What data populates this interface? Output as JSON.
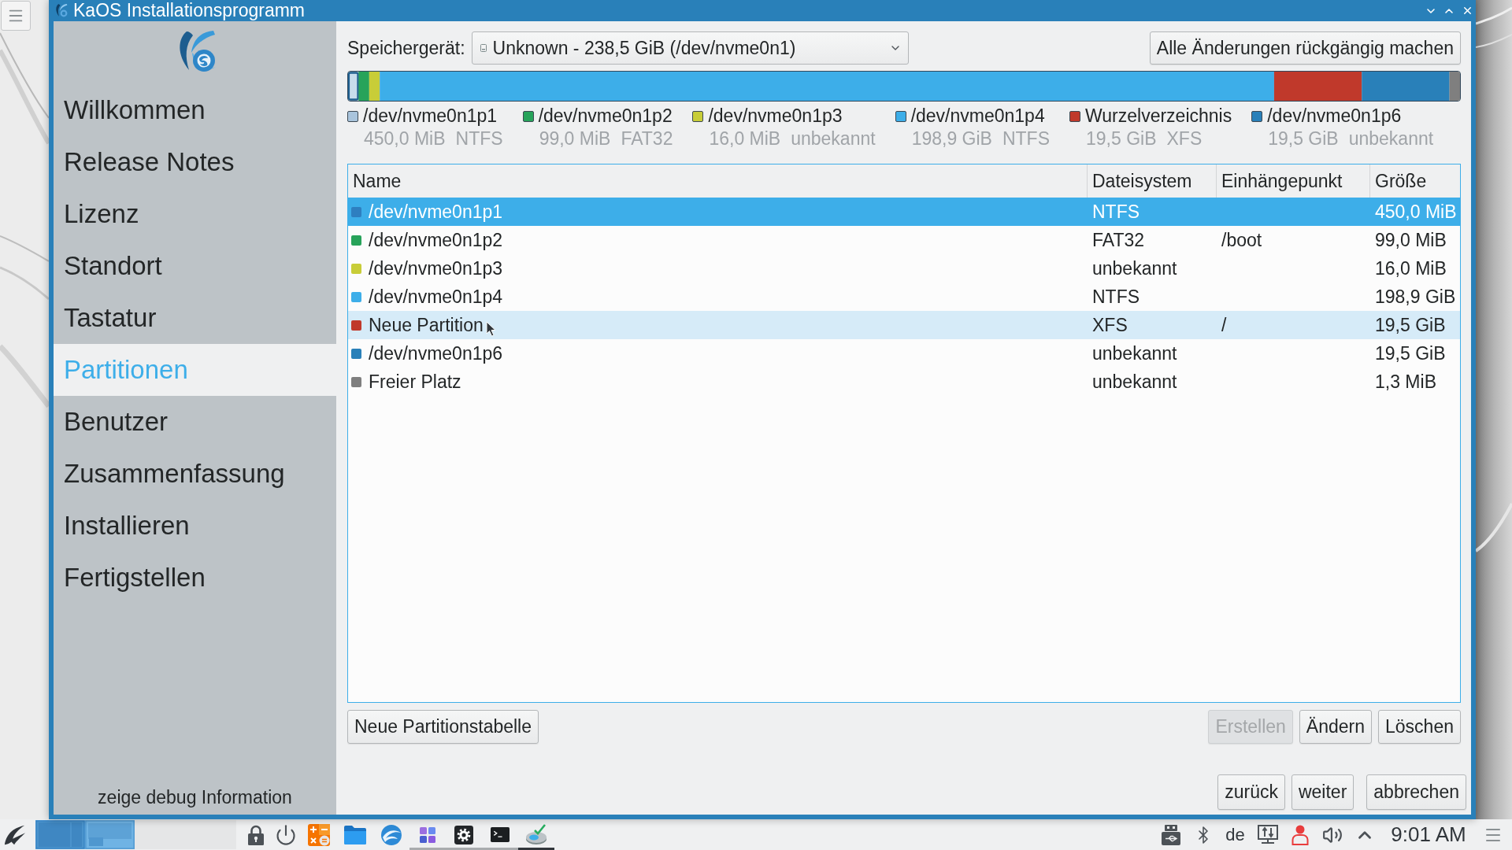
{
  "window": {
    "title": "KaOS Installationsprogramm"
  },
  "sidebar": {
    "items": [
      {
        "label": "Willkommen",
        "selected": false
      },
      {
        "label": "Release Notes",
        "selected": false
      },
      {
        "label": "Lizenz",
        "selected": false
      },
      {
        "label": "Standort",
        "selected": false
      },
      {
        "label": "Tastatur",
        "selected": false
      },
      {
        "label": "Partitionen",
        "selected": true
      },
      {
        "label": "Benutzer",
        "selected": false
      },
      {
        "label": "Zusammenfassung",
        "selected": false
      },
      {
        "label": "Installieren",
        "selected": false
      },
      {
        "label": "Fertigstellen",
        "selected": false
      }
    ],
    "debug_button": "zeige debug Information"
  },
  "device": {
    "label": "Speichergerät:",
    "value": "Unknown - 238,5 GiB (/dev/nvme0n1)"
  },
  "revert_button": {
    "label": "Alle Änderungen rückgängig machen",
    "disabled": false
  },
  "legend": [
    {
      "name": "/dev/nvme0n1p1",
      "color": "#a9c4dc",
      "size": "450,0 MiB",
      "filesystem": "NTFS"
    },
    {
      "name": "/dev/nvme0n1p2",
      "color": "#27a35a",
      "size": "99,0 MiB",
      "filesystem": "FAT32"
    },
    {
      "name": "/dev/nvme0n1p3",
      "color": "#c8cd38",
      "size": "16,0 MiB",
      "filesystem": "unbekannt"
    },
    {
      "name": "/dev/nvme0n1p4",
      "color": "#3daee9",
      "size": "198,9 GiB",
      "filesystem": "NTFS"
    },
    {
      "name": "Wurzelverzeichnis",
      "color": "#c0392b",
      "size": "19,5 GiB",
      "filesystem": "XFS"
    },
    {
      "name": "/dev/nvme0n1p6",
      "color": "#2980b9",
      "size": "19,5 GiB",
      "filesystem": "unbekannt"
    }
  ],
  "table": {
    "columns": [
      "Name",
      "Dateisystem",
      "Einhängepunkt",
      "Größe"
    ],
    "rows": [
      {
        "name": "/dev/nvme0n1p1",
        "color": "#2e7fc0",
        "filesystem": "NTFS",
        "size": "450,0 MiB",
        "selected": true,
        "hovered": false
      },
      {
        "name": "/dev/nvme0n1p2",
        "color": "#27a35a",
        "filesystem": "FAT32",
        "mount": "/boot",
        "size": "99,0 MiB",
        "selected": false,
        "hovered": false
      },
      {
        "name": "/dev/nvme0n1p3",
        "color": "#c8cd38",
        "filesystem": "unbekannt",
        "size": "16,0 MiB",
        "selected": false,
        "hovered": false
      },
      {
        "name": "/dev/nvme0n1p4",
        "color": "#3daee9",
        "filesystem": "NTFS",
        "size": "198,9 GiB",
        "selected": false,
        "hovered": false
      },
      {
        "name": "Neue Partition",
        "color": "#c0392b",
        "filesystem": "XFS",
        "mount": "/",
        "size": "19,5 GiB",
        "selected": false,
        "hovered": true
      },
      {
        "name": "/dev/nvme0n1p6",
        "color": "#2980b9",
        "filesystem": "unbekannt",
        "size": "19,5 GiB",
        "selected": false,
        "hovered": false
      },
      {
        "name": "Freier Platz",
        "color": "#7f7f7f",
        "filesystem": "unbekannt",
        "size": "1,3 MiB",
        "selected": false,
        "hovered": false
      }
    ]
  },
  "partition_buttons": {
    "left": [
      {
        "label": "Neue Partitionstabelle",
        "disabled": false
      }
    ],
    "right": [
      {
        "label": "Erstellen",
        "disabled": true
      },
      {
        "label": "Ändern",
        "disabled": false
      },
      {
        "label": "Löschen",
        "disabled": false
      }
    ]
  },
  "nav_buttons": [
    {
      "label": "zurück",
      "disabled": false
    },
    {
      "label": "weiter",
      "disabled": false
    }
  ],
  "cancel_button": {
    "label": "abbrechen",
    "disabled": false
  },
  "taskbar": {
    "launchers": [
      {
        "kind": "lock",
        "running": false,
        "active": false
      },
      {
        "kind": "power",
        "running": false,
        "active": false
      },
      {
        "kind": "calculator",
        "running": false,
        "active": false
      },
      {
        "kind": "folder",
        "running": false,
        "active": false
      },
      {
        "kind": "browser",
        "running": false,
        "active": false
      },
      {
        "kind": "grid",
        "running": true,
        "active": false
      },
      {
        "kind": "settings",
        "running": true,
        "active": false
      },
      {
        "kind": "terminal",
        "running": true,
        "active": false
      },
      {
        "kind": "installer",
        "running": true,
        "active": true
      }
    ],
    "keyboard_layout": "de",
    "clock": "9:01 AM"
  }
}
